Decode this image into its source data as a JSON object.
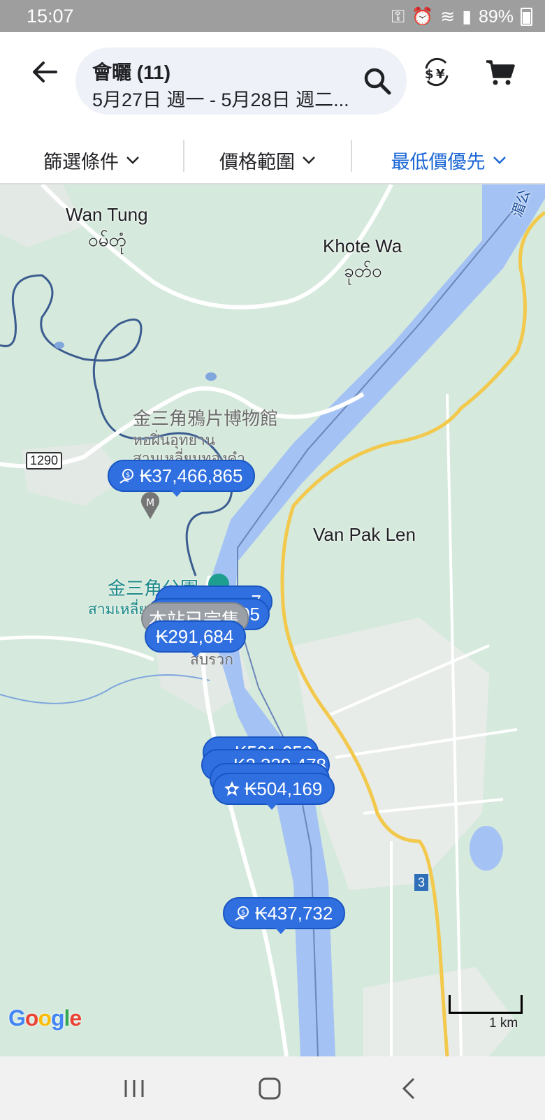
{
  "status_bar": {
    "time": "15:07",
    "battery": "89%"
  },
  "header": {
    "title": "會曬 (11)",
    "dates": "5月27日 週一 - 5月28日 週二...",
    "icons": [
      "back-arrow-icon",
      "search-icon",
      "currency-exchange-icon",
      "cart-icon"
    ]
  },
  "filters": {
    "filter_label": "篩選條件",
    "price_label": "價格範圍",
    "sort_label": "最低價優先"
  },
  "map": {
    "places": {
      "wan_tung": "Wan Tung",
      "wan_tung_local": "ဝမ်တုံ",
      "khote_wa": "Khote Wa",
      "khote_wa_local": "ခုတ်ဝ",
      "van_pak_len": "Van Pak Len",
      "museum": "金三角鴉片博物館",
      "museum_thai_1": "หอฝิ่นอุทยาน",
      "museum_thai_2": "สามเหลี่ยมทองคำ",
      "park": "金三角公園",
      "park_thai": "สามเหลี่ย",
      "town_thai": "สบรวก",
      "route_1290": "1290",
      "route_3": "3",
      "top_right_label": "湄公",
      "attribution": "Google",
      "scale": "1 km"
    },
    "pins": {
      "p1": "₭37,466,865",
      "p2": "₭291,684",
      "p3": "₭504,169",
      "p4": "₭437,732",
      "p_hidden_1": "₭501,053",
      "p_hidden_2": "₭2,329,478",
      "p_partial_a": "7",
      "p_partial_b": "05",
      "sold_out": "本站已完售"
    }
  }
}
